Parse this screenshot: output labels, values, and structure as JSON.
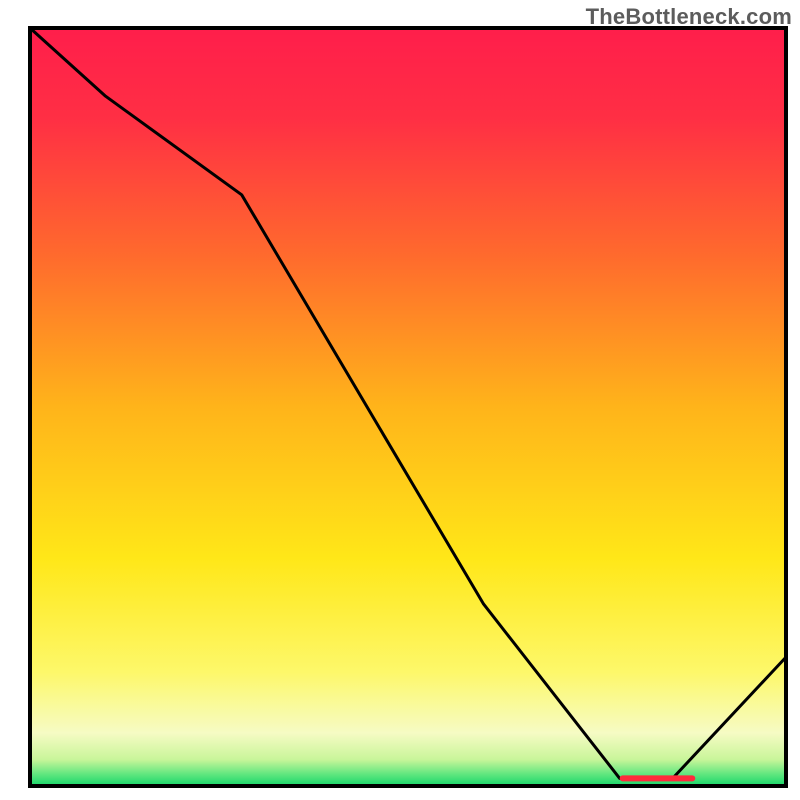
{
  "watermark": "TheBottleneck.com",
  "chart_data": {
    "type": "line",
    "title": "",
    "xlabel": "",
    "ylabel": "",
    "xlim": [
      0,
      100
    ],
    "ylim": [
      0,
      100
    ],
    "series": [
      {
        "name": "curve",
        "x": [
          0,
          10,
          28,
          60,
          78,
          85,
          100
        ],
        "y": [
          100,
          91,
          78,
          24,
          1,
          1,
          17
        ]
      }
    ],
    "optimum_band": {
      "x_start": 78,
      "x_end": 88,
      "y": 1
    },
    "background_gradient": {
      "stops": [
        {
          "offset": 0.0,
          "color": "#ff1e4b"
        },
        {
          "offset": 0.12,
          "color": "#ff2f44"
        },
        {
          "offset": 0.3,
          "color": "#ff6a2d"
        },
        {
          "offset": 0.5,
          "color": "#ffb41a"
        },
        {
          "offset": 0.7,
          "color": "#ffe718"
        },
        {
          "offset": 0.85,
          "color": "#fdf86a"
        },
        {
          "offset": 0.93,
          "color": "#f6fbc4"
        },
        {
          "offset": 0.965,
          "color": "#c9f59a"
        },
        {
          "offset": 0.985,
          "color": "#5de67e"
        },
        {
          "offset": 1.0,
          "color": "#17d66a"
        }
      ]
    }
  }
}
